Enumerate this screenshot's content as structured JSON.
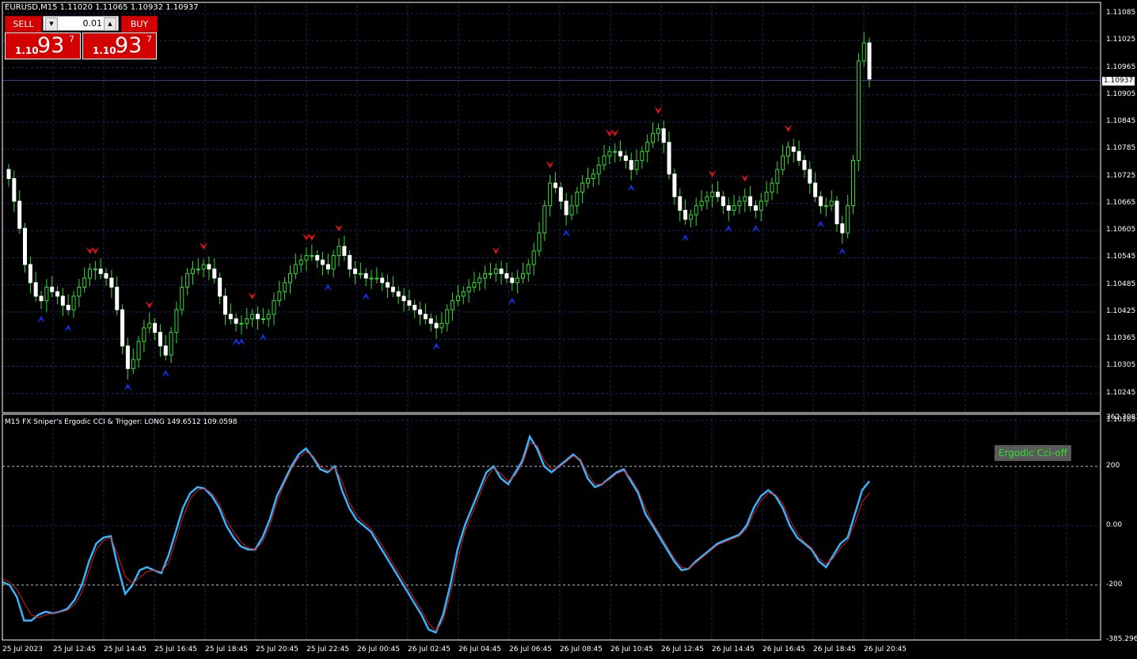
{
  "chart_header": {
    "symbol_line": "EURUSD,M15  1.11020 1.11065 1.10932 1.10937"
  },
  "trade_panel": {
    "sell_label": "SELL",
    "buy_label": "BUY",
    "lot_value": "0.01",
    "sell_price": {
      "prefix": "1.10",
      "big": "93",
      "sup": "7"
    },
    "buy_price": {
      "prefix": "1.10",
      "big": "93",
      "sup": "7"
    }
  },
  "indicator": {
    "title": "M15 FX Sniper's Ergodic CCI & Trigger: LONG 149.6512 109.0598",
    "button_label": "Ergodic Cci-off"
  },
  "colors": {
    "background": "#000000",
    "grid": "#1c2a66",
    "candle_body": "#ffffff",
    "candle_wick": "#33dd33",
    "sell_arrow": "#e01010",
    "buy_arrow": "#1030e0",
    "cci_line": "#33b5ff",
    "trigger_line": "#e01a1a",
    "current_price_line": "#3c3c8c"
  },
  "current_price_label": "1.10937",
  "chart_data": [
    {
      "type": "candlestick",
      "symbol": "EURUSD",
      "timeframe": "M15",
      "ylim": [
        1.10185,
        1.11085
      ],
      "y_ticks": [
        "1.11085",
        "1.11025",
        "1.10965",
        "1.10905",
        "1.10845",
        "1.10785",
        "1.10725",
        "1.10665",
        "1.10605",
        "1.10545",
        "1.10485",
        "1.10425",
        "1.10365",
        "1.10305",
        "1.10245",
        "1.10185"
      ],
      "x_ticks": [
        "25 Jul 2023",
        "25 Jul 12:45",
        "25 Jul 14:45",
        "25 Jul 16:45",
        "25 Jul 18:45",
        "25 Jul 20:45",
        "25 Jul 22:45",
        "26 Jul 00:45",
        "26 Jul 02:45",
        "26 Jul 04:45",
        "26 Jul 06:45",
        "26 Jul 08:45",
        "26 Jul 10:45",
        "26 Jul 12:45",
        "26 Jul 14:45",
        "26 Jul 16:45",
        "26 Jul 18:45",
        "26 Jul 20:45"
      ],
      "current_price": 1.10937,
      "close": [
        1.1072,
        1.1067,
        1.1061,
        1.1053,
        1.1049,
        1.1046,
        1.1045,
        1.1048,
        1.1047,
        1.1046,
        1.1044,
        1.1043,
        1.1046,
        1.1048,
        1.105,
        1.1052,
        1.1052,
        1.1051,
        1.105,
        1.1048,
        1.1043,
        1.1035,
        1.103,
        1.1032,
        1.1036,
        1.1039,
        1.104,
        1.1038,
        1.1035,
        1.1033,
        1.1038,
        1.1043,
        1.1048,
        1.1051,
        1.1052,
        1.1052,
        1.1053,
        1.1052,
        1.105,
        1.1046,
        1.1042,
        1.1041,
        1.104,
        1.104,
        1.1041,
        1.1042,
        1.1041,
        1.1041,
        1.1042,
        1.1045,
        1.1047,
        1.1049,
        1.1051,
        1.1053,
        1.1054,
        1.1055,
        1.1055,
        1.1054,
        1.1053,
        1.1052,
        1.1055,
        1.1057,
        1.1055,
        1.1052,
        1.1051,
        1.1051,
        1.105,
        1.105,
        1.105,
        1.1049,
        1.1048,
        1.1047,
        1.1046,
        1.1045,
        1.1044,
        1.1043,
        1.1042,
        1.1041,
        1.104,
        1.1039,
        1.104,
        1.1043,
        1.1045,
        1.1046,
        1.1047,
        1.1048,
        1.1049,
        1.105,
        1.1051,
        1.1051,
        1.1052,
        1.1051,
        1.105,
        1.1049,
        1.105,
        1.1051,
        1.1053,
        1.1056,
        1.106,
        1.1066,
        1.1071,
        1.107,
        1.1067,
        1.1064,
        1.1066,
        1.1069,
        1.1071,
        1.1072,
        1.1073,
        1.1075,
        1.1077,
        1.1078,
        1.1078,
        1.1077,
        1.1076,
        1.1074,
        1.1076,
        1.1078,
        1.108,
        1.1082,
        1.1083,
        1.108,
        1.1073,
        1.1068,
        1.1065,
        1.1063,
        1.1064,
        1.1066,
        1.1067,
        1.1068,
        1.1069,
        1.1068,
        1.1066,
        1.1065,
        1.1066,
        1.1067,
        1.1068,
        1.1066,
        1.1065,
        1.1067,
        1.1069,
        1.1071,
        1.1074,
        1.1077,
        1.1079,
        1.1078,
        1.1076,
        1.1074,
        1.1071,
        1.1068,
        1.1066,
        1.1066,
        1.1067,
        1.1062,
        1.106,
        1.1066,
        1.1076,
        1.1098,
        1.1102,
        1.1094
      ]
    },
    {
      "type": "line",
      "title": "M15 FX Sniper's Ergodic CCI & Trigger: LONG 149.6512 109.0598",
      "ylim": [
        -385.2962,
        362.3083
      ],
      "y_ticks": [
        "362.3083",
        "200",
        "0.00",
        "-200",
        "-385.2962"
      ],
      "levels": [
        200,
        -200
      ],
      "series": [
        {
          "values": [
            -190,
            -200,
            -240,
            -320,
            -320,
            -300,
            -290,
            -295,
            -290,
            -280,
            -250,
            -200,
            -120,
            -60,
            -40,
            -35,
            -140,
            -230,
            -200,
            -150,
            -140,
            -150,
            -160,
            -100,
            -20,
            60,
            110,
            130,
            125,
            100,
            60,
            0,
            -40,
            -70,
            -80,
            -80,
            -40,
            20,
            100,
            150,
            200,
            240,
            260,
            230,
            190,
            180,
            200,
            120,
            60,
            20,
            0,
            -20,
            -60,
            -100,
            -140,
            -180,
            -220,
            -260,
            -300,
            -350,
            -360,
            -300,
            -200,
            -80,
            0,
            60,
            120,
            180,
            200,
            160,
            140,
            180,
            220,
            300,
            260,
            200,
            180,
            200,
            220,
            240,
            220,
            160,
            130,
            140,
            160,
            180,
            190,
            150,
            110,
            40,
            0,
            -40,
            -80,
            -120,
            -150,
            -145,
            -120,
            -100,
            -80,
            -60,
            -50,
            -40,
            -30,
            0,
            60,
            100,
            120,
            100,
            60,
            0,
            -40,
            -60,
            -80,
            -120,
            -140,
            -100,
            -60,
            -40,
            40,
            120,
            150
          ]
        },
        {
          "values": [
            -180,
            -190,
            -215,
            -260,
            -300,
            -310,
            -300,
            -295,
            -292,
            -285,
            -265,
            -225,
            -150,
            -80,
            -50,
            -40,
            -100,
            -170,
            -195,
            -175,
            -155,
            -150,
            -155,
            -125,
            -50,
            30,
            90,
            120,
            125,
            110,
            75,
            20,
            -20,
            -55,
            -75,
            -80,
            -55,
            0,
            80,
            140,
            190,
            230,
            250,
            235,
            200,
            185,
            195,
            150,
            80,
            35,
            10,
            -10,
            -45,
            -85,
            -125,
            -165,
            -205,
            -245,
            -285,
            -330,
            -355,
            -320,
            -230,
            -120,
            -20,
            40,
            100,
            160,
            195,
            175,
            150,
            170,
            210,
            280,
            270,
            220,
            190,
            195,
            215,
            235,
            225,
            175,
            140,
            140,
            155,
            175,
            185,
            160,
            120,
            60,
            10,
            -30,
            -70,
            -110,
            -140,
            -145,
            -125,
            -105,
            -85,
            -65,
            -55,
            -45,
            -35,
            -10,
            40,
            85,
            110,
            105,
            75,
            20,
            -25,
            -55,
            -75,
            -110,
            -130,
            -110,
            -75,
            -50,
            10,
            80,
            110
          ]
        }
      ]
    }
  ]
}
